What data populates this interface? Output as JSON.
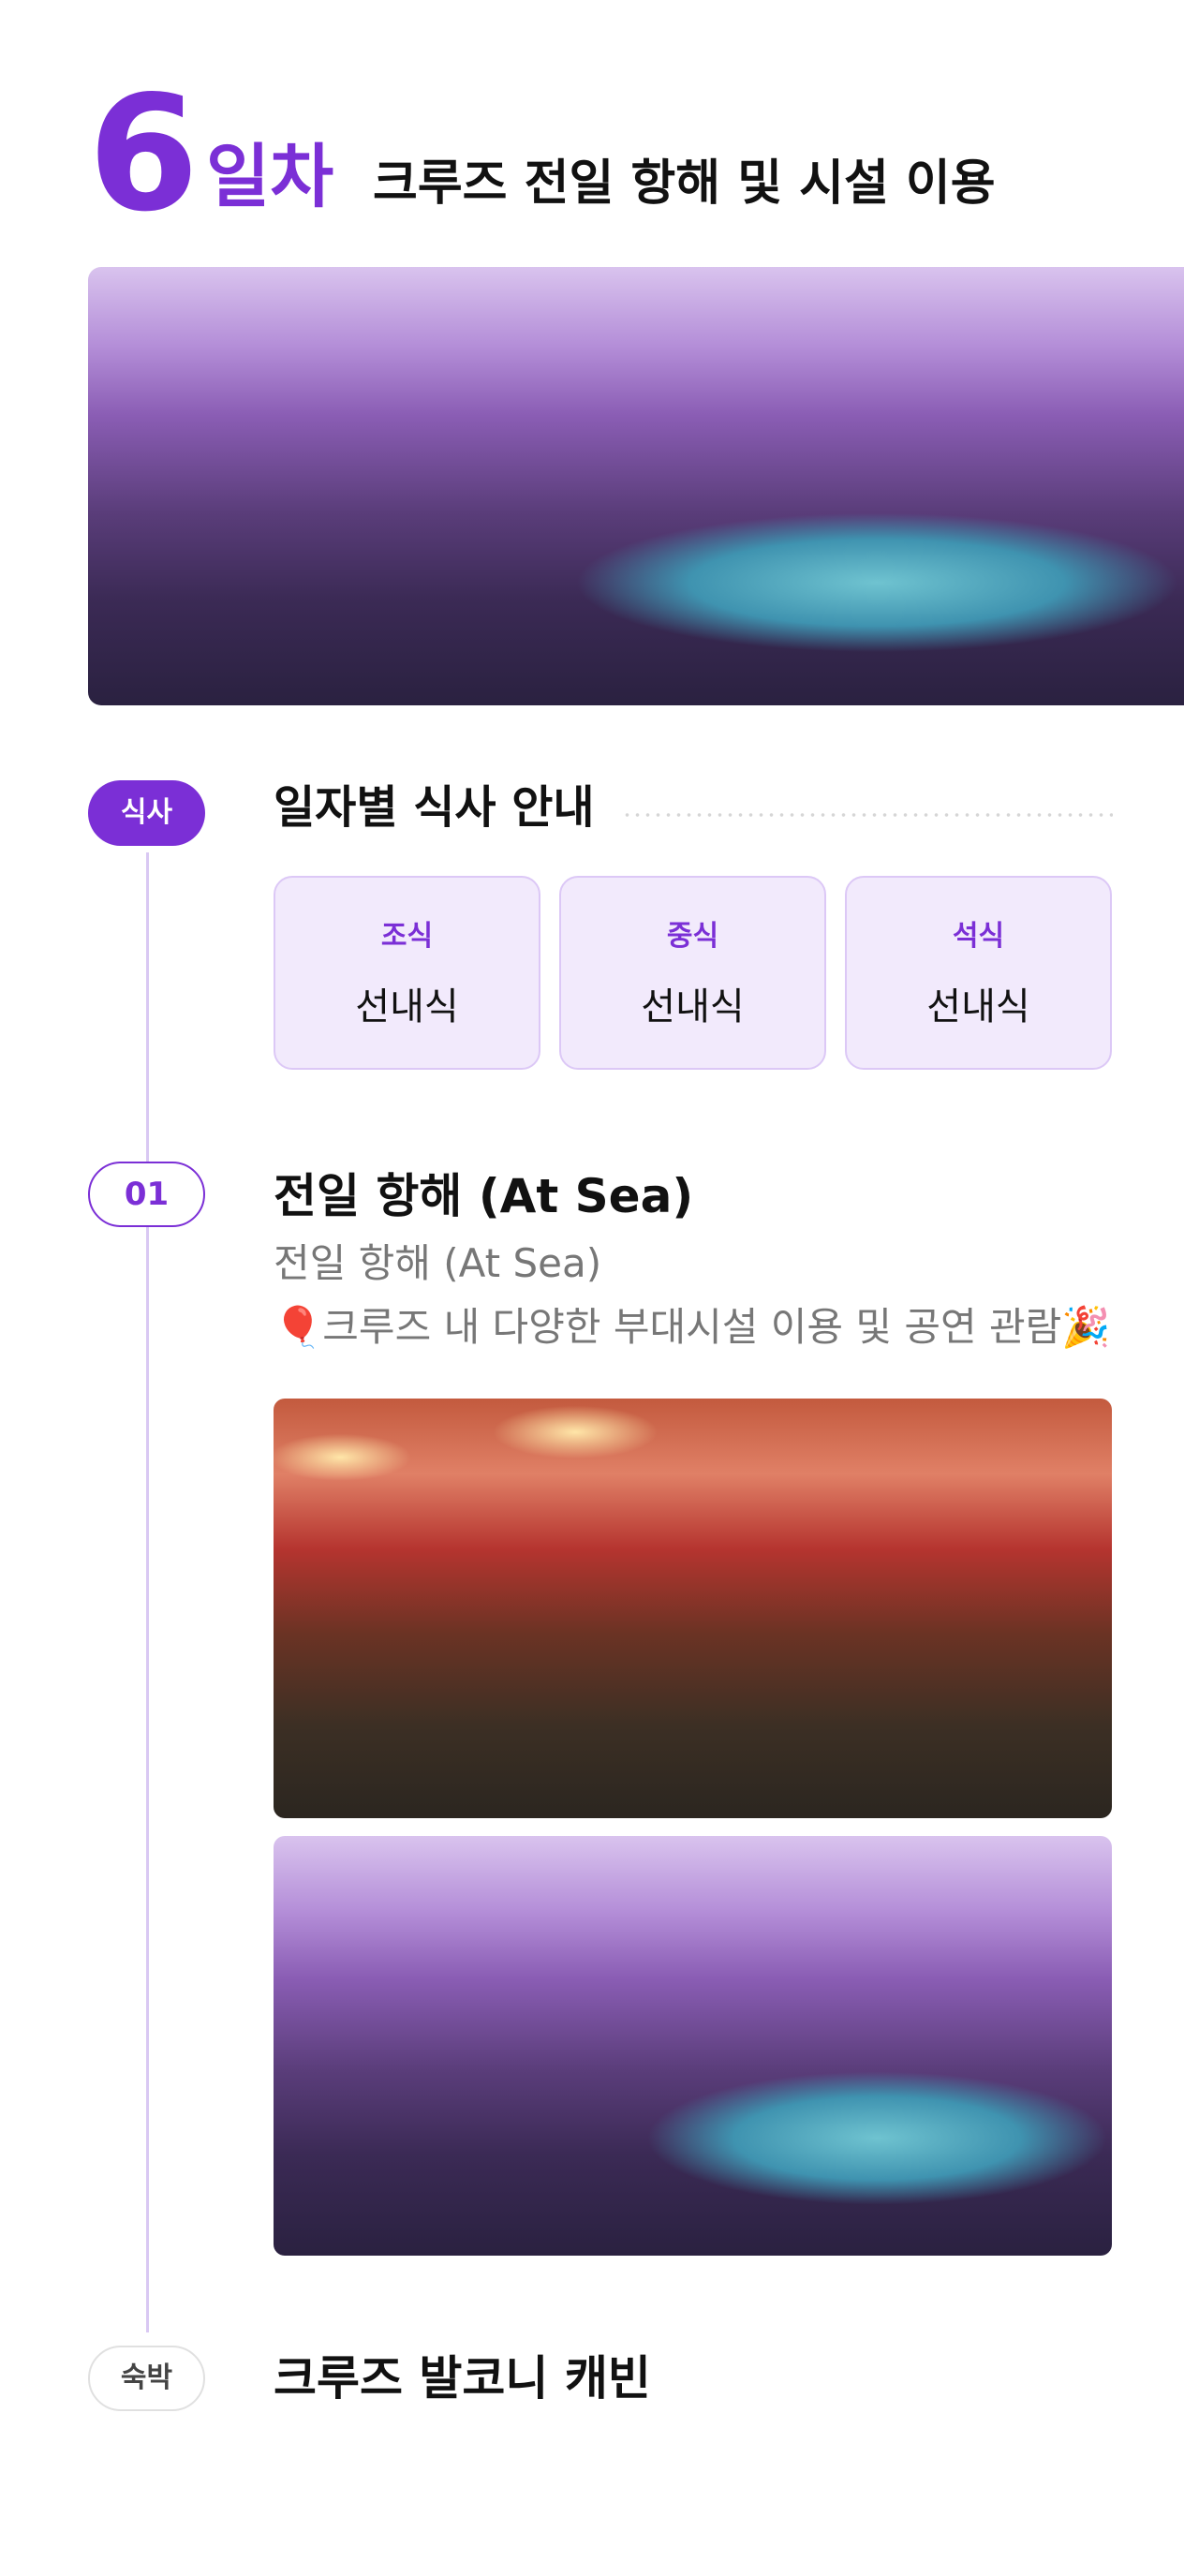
{
  "header": {
    "day_number": "6",
    "day_unit": "일차",
    "title": "크루즈 전일 항해 및 시설 이용"
  },
  "meal": {
    "badge": "식사",
    "heading": "일자별 식사 안내",
    "items": [
      {
        "label": "조식",
        "value": "선내식"
      },
      {
        "label": "중식",
        "value": "선내식"
      },
      {
        "label": "석식",
        "value": "선내식"
      }
    ]
  },
  "schedule": [
    {
      "badge": "01",
      "title": "전일 항해 (At Sea)",
      "subtitle": "전일 항해 (At Sea)",
      "description": "🎈크루즈 내 다양한 부대시설 이용 및 공연 관람🎉"
    }
  ],
  "stay": {
    "badge": "숙박",
    "title": "크루즈 발코니 캐빈"
  },
  "colors": {
    "accent": "#7b2fd6",
    "card_bg": "#f2eafc",
    "card_border": "#dcc8f6",
    "timeline": "#d9c8f3"
  }
}
